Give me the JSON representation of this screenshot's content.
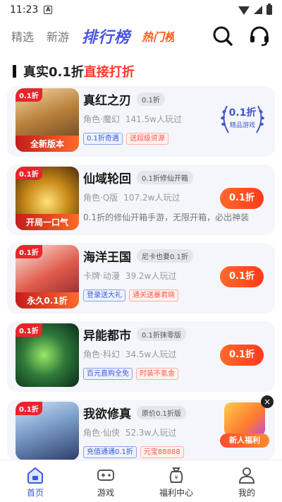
{
  "status_bar": {
    "time": "11:23",
    "notif_letter": "A"
  },
  "top_nav": {
    "tabs": [
      {
        "label": "精选"
      },
      {
        "label": "新游"
      },
      {
        "label": "排行榜"
      },
      {
        "label": "热门榜"
      }
    ],
    "active_index": 2
  },
  "section": {
    "title_part1": "真实0.1折",
    "title_part2": "直接打折"
  },
  "games": [
    {
      "name": "真红之刃",
      "pill": "0.1折",
      "category": "角色·魔幻",
      "players": "141.5w人玩过",
      "cover_badge": "0.1折",
      "cover_ribbon": "全新版本",
      "tags": [
        {
          "text": "0.1折奇遇",
          "color": "blue"
        },
        {
          "text": "送超级资源",
          "color": "red"
        }
      ],
      "action": {
        "type": "laurel",
        "main": "0.1折",
        "sub": "精品游戏"
      }
    },
    {
      "name": "仙域轮回",
      "pill": "0.1折修仙开箱",
      "category": "角色·Q版",
      "players": "107.2w人玩过",
      "cover_badge": "0.1折",
      "cover_ribbon": "开局一口气",
      "description": "0.1折的修仙开箱手游，无限开箱，必出神装",
      "action": {
        "type": "button",
        "label": "0.1折"
      }
    },
    {
      "name": "海洋王国",
      "pill": "尼卡也要0.1折",
      "category": "卡牌·动漫",
      "players": "39.2w人玩过",
      "cover_badge": "0.1折",
      "cover_ribbon": "永久0.1折",
      "tags": [
        {
          "text": "登录送大礼",
          "color": "blue"
        },
        {
          "text": "通关送暴君晓",
          "color": "red"
        }
      ],
      "action": {
        "type": "button",
        "label": "0.1折"
      }
    },
    {
      "name": "异能都市",
      "pill": "0.1折抹零版",
      "category": "角色·科幻",
      "players": "34.5w人玩过",
      "cover_badge": "0.1折",
      "cover_ribbon": "",
      "tags": [
        {
          "text": "百元直购全免",
          "color": "blue"
        },
        {
          "text": "时装不氪金",
          "color": "red"
        }
      ],
      "action": {
        "type": "button",
        "label": "0.1折"
      }
    },
    {
      "name": "我欲修真",
      "pill": "原价0.1折版",
      "category": "角色·仙侠",
      "players": "52.3w人玩过",
      "cover_badge": "0.1折",
      "cover_ribbon": "",
      "tags": [
        {
          "text": "充值通通0.1折",
          "color": "blue"
        },
        {
          "text": "元宝88888",
          "color": "red"
        }
      ],
      "action": {
        "type": "none"
      }
    }
  ],
  "floating": {
    "label": "新人福利",
    "close": "×"
  },
  "bottom_nav": [
    {
      "label": "首页",
      "icon": "home-icon"
    },
    {
      "label": "游戏",
      "icon": "gamepad-icon"
    },
    {
      "label": "福利中心",
      "icon": "gift-bag-icon"
    },
    {
      "label": "我的",
      "icon": "user-icon"
    }
  ],
  "colors": {
    "accent_blue": "#3a5bd9",
    "accent_red": "#ff3b2f",
    "card_bg": "#f4f6fb"
  }
}
